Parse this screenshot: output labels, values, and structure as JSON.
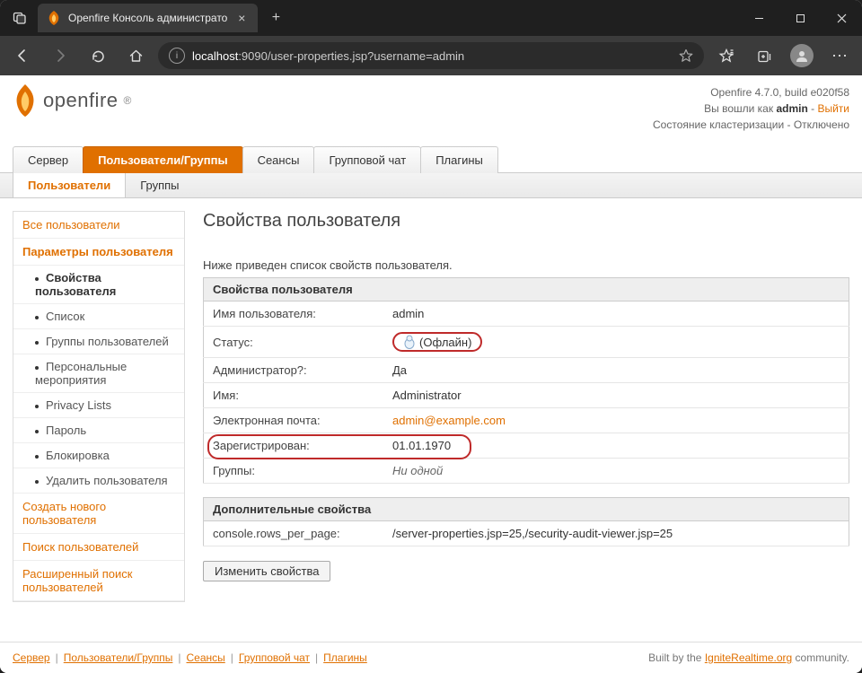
{
  "browser": {
    "tab_title": "Openfire Консоль администрато",
    "url_host": "localhost",
    "url_port_path": ":9090/user-properties.jsp?username=admin"
  },
  "header": {
    "product": "openfire",
    "version_line": "Openfire 4.7.0, build e020f58",
    "login_prefix": "Вы вошли как ",
    "login_user": "admin",
    "logout": "Выйти",
    "cluster_line": "Состояние кластеризации - Отключено"
  },
  "maintabs": [
    "Сервер",
    "Пользователи/Группы",
    "Сеансы",
    "Групповой чат",
    "Плагины"
  ],
  "maintab_active": 1,
  "subtabs": [
    "Пользователи",
    "Группы"
  ],
  "subtab_active": 0,
  "sidebar": {
    "items": [
      {
        "label": "Все пользователи",
        "type": "h"
      },
      {
        "label": "Параметры пользователя",
        "type": "h",
        "bold": true
      },
      {
        "label": "Свойства пользователя",
        "type": "sub",
        "selected": true
      },
      {
        "label": "Список",
        "type": "sub"
      },
      {
        "label": "Группы пользователей",
        "type": "sub"
      },
      {
        "label": "Персональные мероприятия",
        "type": "sub"
      },
      {
        "label": "Privacy Lists",
        "type": "sub"
      },
      {
        "label": "Пароль",
        "type": "sub"
      },
      {
        "label": "Блокировка",
        "type": "sub"
      },
      {
        "label": "Удалить пользователя",
        "type": "sub"
      },
      {
        "label": "Создать нового пользователя",
        "type": "h"
      },
      {
        "label": "Поиск пользователей",
        "type": "h"
      },
      {
        "label": "Расширенный поиск пользователей",
        "type": "h"
      }
    ]
  },
  "content": {
    "title": "Свойства пользователя",
    "intro": "Ниже приведен список свойств пользователя.",
    "props_header": "Свойства пользователя",
    "rows": [
      {
        "k": "Имя пользователя:",
        "v": "admin"
      },
      {
        "k": "Статус:",
        "v": "(Офлайн)",
        "icon": true,
        "hl_v": true
      },
      {
        "k": "Администратор?:",
        "v": "Да"
      },
      {
        "k": "Имя:",
        "v": "Administrator"
      },
      {
        "k": "Электронная почта:",
        "v": "admin@example.com",
        "link": true
      },
      {
        "k": "Зарегистрирован:",
        "v": "01.01.1970",
        "hl_row": true
      },
      {
        "k": "Группы:",
        "v": "Ни одной",
        "ital": true
      }
    ],
    "extra_header": "Дополнительные свойства",
    "extra_rows": [
      {
        "k": "console.rows_per_page:",
        "v": "/server-properties.jsp=25,/security-audit-viewer.jsp=25"
      }
    ],
    "edit_button": "Изменить свойства"
  },
  "footer": {
    "links": [
      "Сервер",
      "Пользователи/Группы",
      "Сеансы",
      "Групповой чат",
      "Плагины"
    ],
    "right_prefix": "Built by the ",
    "right_link": "IgniteRealtime.org",
    "right_suffix": " community."
  }
}
